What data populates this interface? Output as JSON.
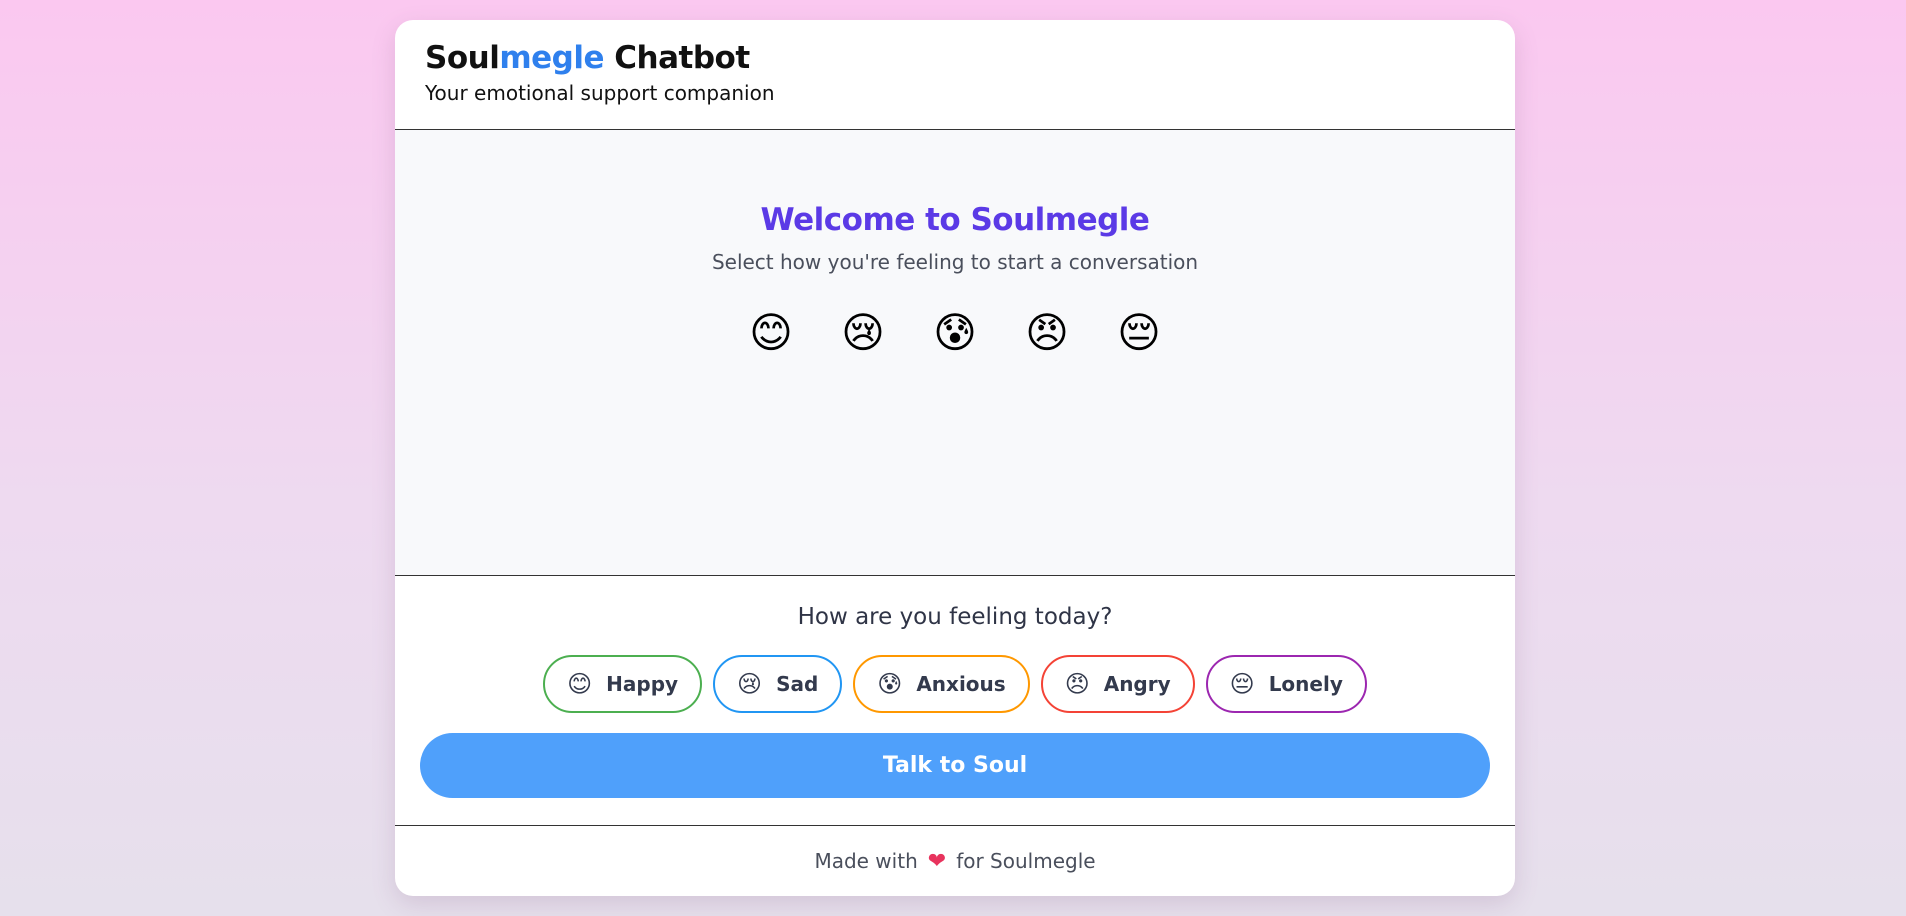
{
  "header": {
    "brand_part1": "Soul",
    "brand_part2": "megle",
    "brand_part3": "Chatbot",
    "tagline": "Your emotional support companion"
  },
  "welcome": {
    "title": "Welcome to Soulmegle",
    "subtitle": "Select how you're feeling to start a conversation"
  },
  "emojis": [
    "😊",
    "😢",
    "😰",
    "😠",
    "😔"
  ],
  "question": "How are you feeling today?",
  "moods": [
    {
      "emoji": "😊",
      "label": "Happy",
      "color": "#4caf50"
    },
    {
      "emoji": "😢",
      "label": "Sad",
      "color": "#2196f3"
    },
    {
      "emoji": "😰",
      "label": "Anxious",
      "color": "#ff9800"
    },
    {
      "emoji": "😠",
      "label": "Angry",
      "color": "#f44336"
    },
    {
      "emoji": "😔",
      "label": "Lonely",
      "color": "#9c27b0"
    }
  ],
  "talk_button": "Talk to Soul",
  "footer": {
    "made_with": "Made with",
    "heart": "❤",
    "for_text": "for Soulmegle"
  }
}
